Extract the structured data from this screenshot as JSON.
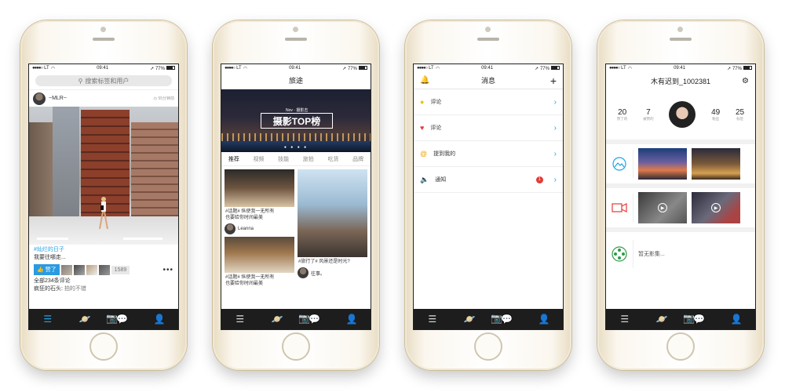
{
  "status": {
    "carrier": "LT",
    "time": "09:41",
    "battery": "77%"
  },
  "accent": "#22a2e6",
  "tabbar": {
    "icons": [
      "list-icon",
      "planet-icon",
      "camera-icon",
      "chat-icon",
      "person-icon"
    ]
  },
  "feed": {
    "search_placeholder": "搜索标签和用户",
    "post": {
      "author": "~MLR~",
      "time": "55分钟前",
      "tag": "#灿烂的日子",
      "text": "我要往哪走...",
      "like_label": "赞了",
      "like_count": "1589",
      "comments": "全部234条评论",
      "comment_user": "疯狂的石头:",
      "comment_text": "拍的不错"
    }
  },
  "discover": {
    "title": "旅途",
    "banner": {
      "month": "Nov · 摄影志",
      "title": "摄影TOP榜"
    },
    "categories": [
      "推荐",
      "视频",
      "技能",
      "旅拍",
      "吃货",
      "品牌"
    ],
    "cards": [
      {
        "text": "#话题# 纵使我一无所有\n也要给你时间最美",
        "author": "Leanna"
      },
      {
        "text": "#话题# 纵使我一无所有\n也要给你时间最美",
        "author": ""
      },
      {
        "text": "#旅行了# 风景还是时光?",
        "author": "往事。"
      }
    ]
  },
  "messages": {
    "title": "消息",
    "rows": [
      {
        "icon": "comment-icon",
        "label": "评论",
        "badge": ""
      },
      {
        "icon": "heart-icon",
        "label": "评论",
        "badge": ""
      },
      {
        "icon": "at-icon",
        "label": "提到我的",
        "badge": ""
      },
      {
        "icon": "speaker-icon",
        "label": "通知",
        "badge": "1"
      }
    ]
  },
  "profile": {
    "name": "木有迟到_1002381",
    "stats": [
      {
        "n": "20",
        "l": "赞了的"
      },
      {
        "n": "7",
        "l": "被赞的"
      },
      {
        "n": "49",
        "l": "粉丝"
      },
      {
        "n": "25",
        "l": "标签"
      }
    ],
    "empty_album": "暂无影集..."
  }
}
